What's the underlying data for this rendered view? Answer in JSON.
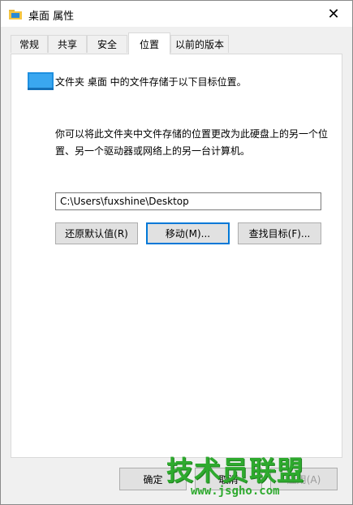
{
  "window": {
    "title": "桌面 属性",
    "close_glyph": "✕"
  },
  "tabs": [
    {
      "label": "常规"
    },
    {
      "label": "共享"
    },
    {
      "label": "安全"
    },
    {
      "label": "位置",
      "active": true
    },
    {
      "label": "以前的版本"
    }
  ],
  "location": {
    "description": "文件夹 桌面 中的文件存储于以下目标位置。",
    "info": "你可以将此文件夹中文件存储的位置更改为此硬盘上的另一个位置、另一个驱动器或网络上的另一台计算机。",
    "path_value": "C:\\Users\\fuxshine\\Desktop",
    "restore_label": "还原默认值(R)",
    "move_label": "移动(M)...",
    "find_label": "查找目标(F)..."
  },
  "footer": {
    "ok_label": "确定",
    "cancel_label": "取消",
    "apply_label": "应用(A)"
  },
  "watermark": {
    "title": "技术员联盟",
    "url": "www.jsgho.com"
  },
  "colors": {
    "accent": "#0078d7",
    "watermark": "#2eaa2e"
  }
}
